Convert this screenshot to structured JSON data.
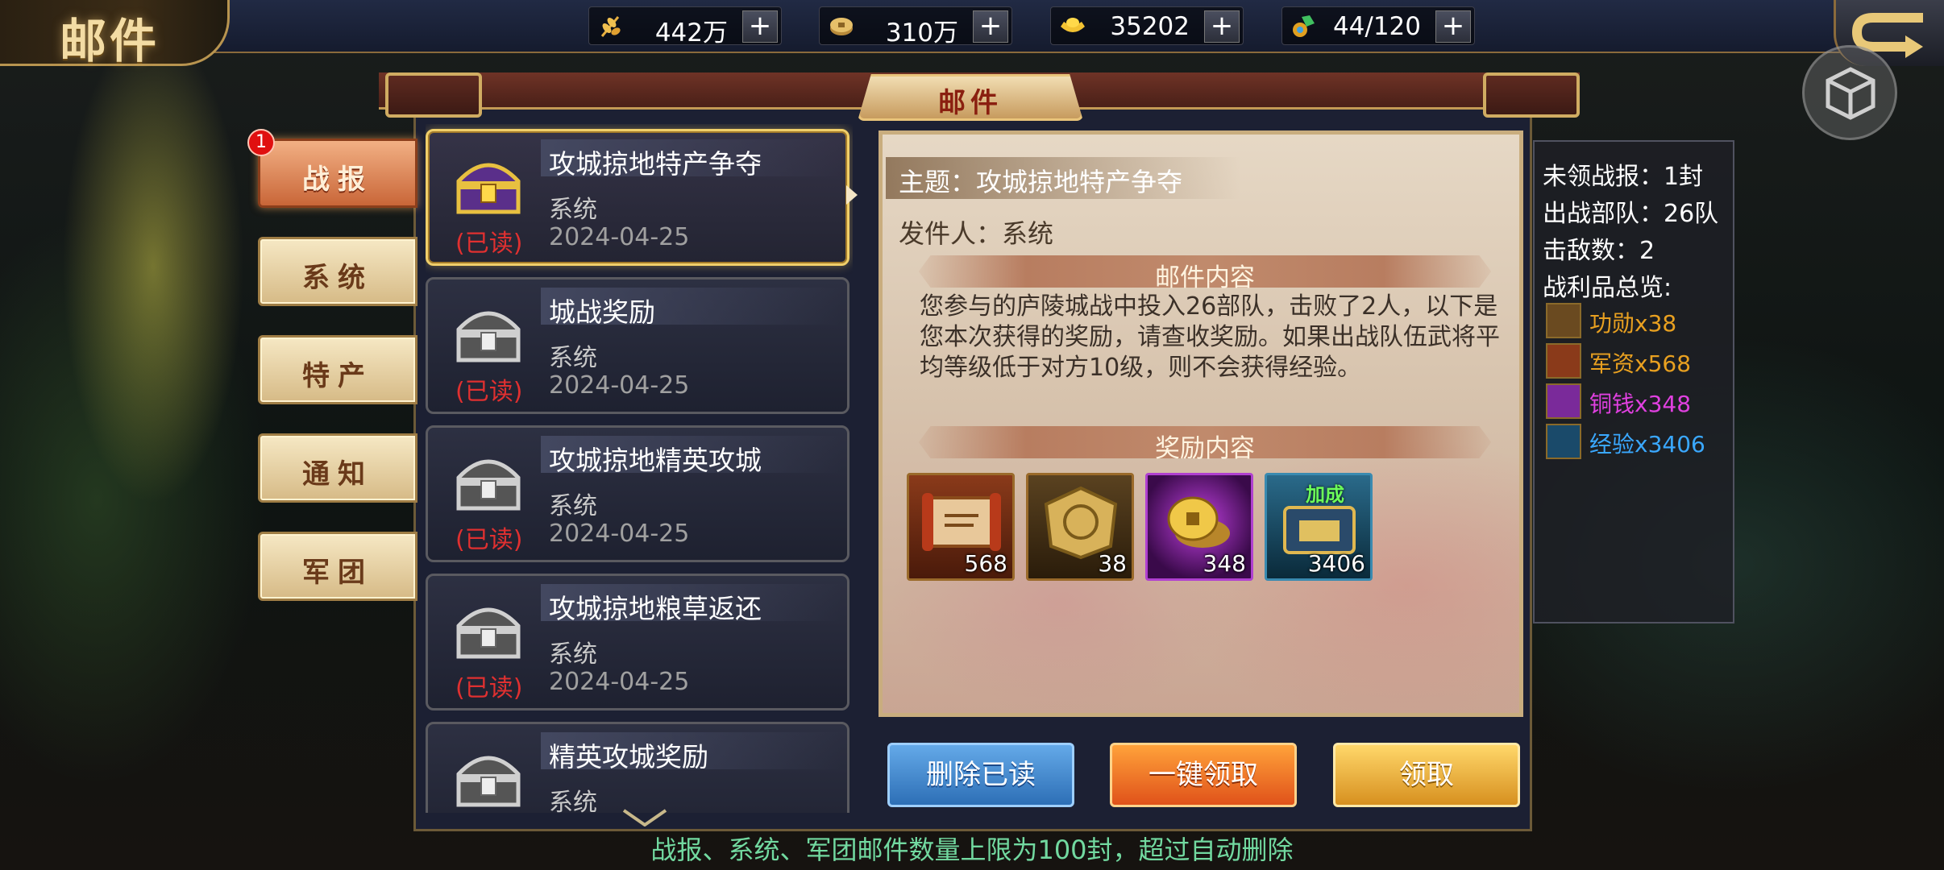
{
  "page": {
    "title": "邮件"
  },
  "resources": [
    {
      "icon": "grain-icon",
      "value": "442万",
      "plus": "+"
    },
    {
      "icon": "copper-coin-icon",
      "value": "310万",
      "plus": "+"
    },
    {
      "icon": "gold-ingot-icon",
      "value": "35202",
      "plus": "+"
    },
    {
      "icon": "stamina-potion-icon",
      "value": "44/120",
      "plus": "+"
    }
  ],
  "panel": {
    "title": "邮件"
  },
  "tabs": [
    {
      "label": "战报",
      "badge": "1",
      "active": true
    },
    {
      "label": "系统"
    },
    {
      "label": "特产"
    },
    {
      "label": "通知"
    },
    {
      "label": "军团"
    }
  ],
  "mails": [
    {
      "subject": "攻城掠地特产争夺",
      "sender": "系统",
      "status": "(已读)",
      "date": "2024-04-25"
    },
    {
      "subject": "城战奖励",
      "sender": "系统",
      "status": "(已读)",
      "date": "2024-04-25"
    },
    {
      "subject": "攻城掠地精英攻城",
      "sender": "系统",
      "status": "(已读)",
      "date": "2024-04-25"
    },
    {
      "subject": "攻城掠地粮草返还",
      "sender": "系统",
      "status": "(已读)",
      "date": "2024-04-25"
    },
    {
      "subject": "精英攻城奖励",
      "sender": "系统",
      "status": "",
      "date": ""
    }
  ],
  "detail": {
    "subject": "主题：攻城掠地特产争夺",
    "sender": "发件人：系统",
    "content_title": "邮件内容",
    "content": "您参与的庐陵城战中投入26部队，击败了2人，以下是您本次获得的奖励，请查收奖励。如果出战队伍武将平均等级低于对方10级，则不会获得经验。",
    "reward_title": "奖励内容",
    "rewards": [
      {
        "icon": "military-supply-scroll-icon",
        "count": "568"
      },
      {
        "icon": "merit-medal-icon",
        "count": "38"
      },
      {
        "icon": "copper-coin-icon",
        "count": "348"
      },
      {
        "icon": "experience-book-icon",
        "count": "3406",
        "bonus": "加成"
      }
    ]
  },
  "summary": {
    "unclaimed": "未领战报：1封",
    "troops": "出战部队：26队",
    "kills": "击敌数：2",
    "loot_title": "战利品总览:",
    "loot": [
      {
        "label": "功勋x38",
        "color": "#e8a020",
        "icon": "merit-medal-icon"
      },
      {
        "label": "军资x568",
        "color": "#e8a020",
        "icon": "military-supply-scroll-icon"
      },
      {
        "label": "铜钱x348",
        "color": "#e040e0",
        "icon": "copper-coin-icon"
      },
      {
        "label": "经验x3406",
        "color": "#3aa8ff",
        "icon": "experience-book-icon"
      }
    ]
  },
  "buttons": {
    "delete_read": "删除已读",
    "claim_all": "一键领取",
    "claim": "领取"
  },
  "footnote": "战报、系统、军团邮件数量上限为100封，超过自动删除"
}
